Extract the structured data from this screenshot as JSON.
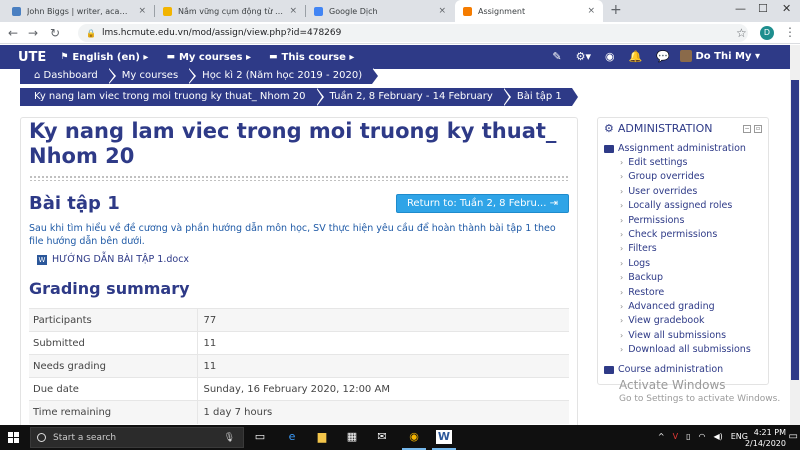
{
  "browser": {
    "tabs": [
      {
        "title": "John Biggs | writer, academic, tra",
        "fav_color": "#4a7fc1"
      },
      {
        "title": "Nắm vững cụm động từ với get, ",
        "fav_color": "#f2b400"
      },
      {
        "title": "Google Dịch",
        "fav_color": "#4285f4"
      },
      {
        "title": "Assignment",
        "fav_color": "#f57c00"
      }
    ],
    "close_glyph": "×",
    "new_tab": "+",
    "url": "lms.hcmute.edu.vn/mod/assign/view.php?id=478269",
    "profile_initial": "D"
  },
  "navbar": {
    "brand": "UTE",
    "lang": "English (en)",
    "my_courses": "My courses",
    "this_course": "This course",
    "user_name": "Do Thi My"
  },
  "breadcrumbs": {
    "row1": [
      "Dashboard",
      "My courses",
      "Học kì 2 (Năm học 2019 - 2020)"
    ],
    "row2": [
      "Ky nang lam viec trong moi truong ky thuat_ Nhom 20",
      "Tuần 2, 8 February - 14 February",
      "Bài tập 1"
    ]
  },
  "main": {
    "course_title": "Ky nang lam viec trong moi truong ky thuat_ Nhom 20",
    "assignment_title": "Bài tập 1",
    "return_button": "Return to: Tuần 2, 8 Febru...",
    "intro": "Sau khi tìm hiểu về đề cương và phần hướng dẫn môn học, SV thực hiện yêu cầu để hoàn thành bài tập 1 theo file hướng dẫn bên dưới.",
    "attachment": "HƯỚNG DẪN BÀI TẬP 1.docx",
    "grading_heading": "Grading summary",
    "grading_rows": [
      {
        "label": "Participants",
        "value": "77"
      },
      {
        "label": "Submitted",
        "value": "11"
      },
      {
        "label": "Needs grading",
        "value": "11"
      },
      {
        "label": "Due date",
        "value": "Sunday, 16 February 2020, 12:00 AM"
      },
      {
        "label": "Time remaining",
        "value": "1 day 7 hours"
      }
    ]
  },
  "admin": {
    "title": "ADMINISTRATION",
    "section": "Assignment administration",
    "items": [
      "Edit settings",
      "Group overrides",
      "User overrides",
      "Locally assigned roles",
      "Permissions",
      "Check permissions",
      "Filters",
      "Logs",
      "Backup",
      "Restore",
      "Advanced grading",
      "View gradebook",
      "View all submissions",
      "Download all submissions"
    ],
    "course_admin": "Course administration"
  },
  "watermark": {
    "line1": "Activate Windows",
    "line2": "Go to Settings to activate Windows."
  },
  "taskbar": {
    "search_placeholder": "Start a search",
    "lang": "ENG",
    "time": "4:21 PM",
    "date": "2/14/2020"
  }
}
